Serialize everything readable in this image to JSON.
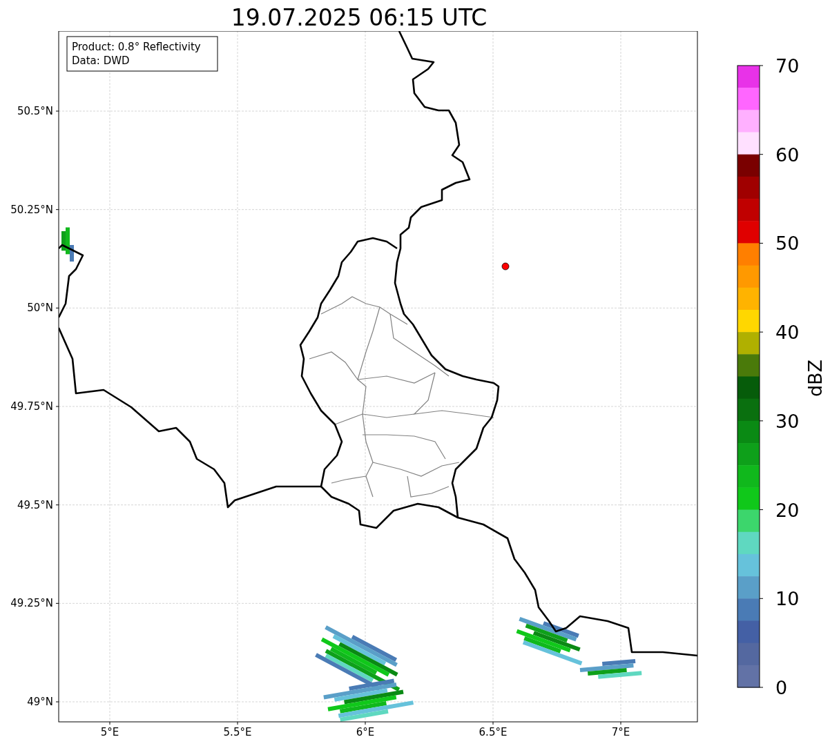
{
  "title": "19.07.2025 06:15 UTC",
  "info_box": {
    "lines": [
      "Product: 0.8° Reflectivity",
      "Data: DWD"
    ]
  },
  "map": {
    "x_ticks": [
      "5°E",
      "5.5°E",
      "6°E",
      "6.5°E",
      "7°E"
    ],
    "y_ticks": [
      "50.5°N",
      "50.25°N",
      "50°N",
      "49.75°N",
      "49.5°N",
      "49.25°N",
      "49°N"
    ]
  },
  "colorbar": {
    "label": "dBZ",
    "ticks": [
      "70",
      "60",
      "50",
      "40",
      "30",
      "20",
      "10",
      "0"
    ],
    "steps": [
      {
        "color": "#e832e8"
      },
      {
        "color": "#ff66ff"
      },
      {
        "color": "#ffb0ff"
      },
      {
        "color": "#ffe0ff"
      },
      {
        "color": "#7a0000"
      },
      {
        "color": "#a00000"
      },
      {
        "color": "#c00000"
      },
      {
        "color": "#e00000"
      },
      {
        "color": "#ff7f00"
      },
      {
        "color": "#ff9900"
      },
      {
        "color": "#ffb300"
      },
      {
        "color": "#ffd700"
      },
      {
        "color": "#b0b000"
      },
      {
        "color": "#4a7a0a"
      },
      {
        "color": "#065c0a"
      },
      {
        "color": "#0a700f"
      },
      {
        "color": "#0a8a14"
      },
      {
        "color": "#0ea01a"
      },
      {
        "color": "#10b81c"
      },
      {
        "color": "#10c81a"
      },
      {
        "color": "#3cd66c"
      },
      {
        "color": "#5fd8c0"
      },
      {
        "color": "#66c2db"
      },
      {
        "color": "#5a9fc8"
      },
      {
        "color": "#4a7bb5"
      },
      {
        "color": "#4460a5"
      },
      {
        "color": "#5468a0"
      },
      {
        "color": "#6272a6"
      }
    ]
  }
}
